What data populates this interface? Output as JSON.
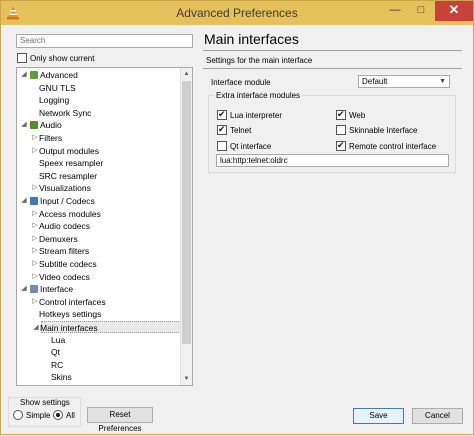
{
  "window": {
    "title": "Advanced Preferences",
    "minimize_glyph": "—",
    "maximize_glyph": "□",
    "close_glyph": "✕"
  },
  "left": {
    "search_placeholder": "Search",
    "only_show_current": {
      "label": "Only show current",
      "checked": false
    },
    "tree": [
      {
        "label": "Advanced",
        "level": 0,
        "expanded": true,
        "icon": "advanced-icon",
        "icon_color": "#5aa02c"
      },
      {
        "label": "GNU TLS",
        "level": 1
      },
      {
        "label": "Logging",
        "level": 1
      },
      {
        "label": "Network Sync",
        "level": 1
      },
      {
        "label": "Audio",
        "level": 0,
        "expanded": true,
        "icon": "audio-icon",
        "icon_color": "#4f8f25"
      },
      {
        "label": "Filters",
        "level": 1,
        "collapsed": true
      },
      {
        "label": "Output modules",
        "level": 1,
        "collapsed": true
      },
      {
        "label": "Speex resampler",
        "level": 1
      },
      {
        "label": "SRC resampler",
        "level": 1
      },
      {
        "label": "Visualizations",
        "level": 1,
        "collapsed": true
      },
      {
        "label": "Input / Codecs",
        "level": 0,
        "expanded": true,
        "icon": "input-codecs-icon",
        "icon_color": "#3d7ab8"
      },
      {
        "label": "Access modules",
        "level": 1,
        "collapsed": true
      },
      {
        "label": "Audio codecs",
        "level": 1,
        "collapsed": true
      },
      {
        "label": "Demuxers",
        "level": 1,
        "collapsed": true
      },
      {
        "label": "Stream filters",
        "level": 1,
        "collapsed": true
      },
      {
        "label": "Subtitle codecs",
        "level": 1,
        "collapsed": true
      },
      {
        "label": "Video codecs",
        "level": 1,
        "collapsed": true
      },
      {
        "label": "Interface",
        "level": 0,
        "expanded": true,
        "icon": "interface-icon",
        "icon_color": "#6a8fb6"
      },
      {
        "label": "Control interfaces",
        "level": 1,
        "collapsed": true
      },
      {
        "label": "Hotkeys settings",
        "level": 1
      },
      {
        "label": "Main interfaces",
        "level": 1,
        "expanded": true,
        "selected": true
      },
      {
        "label": "Lua",
        "level": 2
      },
      {
        "label": "Qt",
        "level": 2
      },
      {
        "label": "RC",
        "level": 2
      },
      {
        "label": "Skins",
        "level": 2
      }
    ],
    "show_settings": {
      "title": "Show settings",
      "simple": {
        "label": "Simple",
        "selected": false
      },
      "all": {
        "label": "All",
        "selected": true
      }
    },
    "reset_label": "Reset Preferences"
  },
  "main": {
    "title": "Main interfaces",
    "subtitle": "Settings for the main interface",
    "interface_module": {
      "label": "Interface module",
      "value": "Default"
    },
    "extra": {
      "title": "Extra interface modules",
      "options": [
        {
          "label": "Lua interpreter",
          "checked": true
        },
        {
          "label": "Web",
          "checked": true
        },
        {
          "label": "Telnet",
          "checked": true
        },
        {
          "label": "Skinnable Interface",
          "checked": false
        },
        {
          "label": "Qt interface",
          "checked": false
        },
        {
          "label": "Remote control interface",
          "checked": true
        }
      ],
      "value": "lua:http:telnet:oldrc"
    }
  },
  "footer": {
    "save_label": "Save",
    "cancel_label": "Cancel"
  }
}
